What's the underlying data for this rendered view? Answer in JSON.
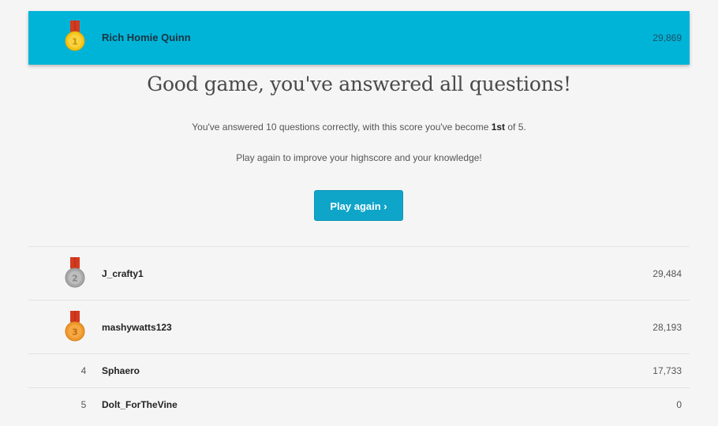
{
  "player": {
    "medal_icon": "gold-medal-icon",
    "medal_number": "1",
    "name": "Rich Homie Quinn",
    "score": "29,869"
  },
  "result": {
    "headline": "Good game, you've answered all questions!",
    "line1_pre": "You've answered 10 questions correctly, with this score you've become ",
    "line1_rank": "1st",
    "line1_post": " of 5.",
    "line2": "Play again to improve your highscore and your knowledge!",
    "play_again_label": "Play again ›"
  },
  "leaderboard": [
    {
      "rank": "2",
      "medal_icon": "silver-medal-icon",
      "name": "J_crafty1",
      "score": "29,484"
    },
    {
      "rank": "3",
      "medal_icon": "bronze-medal-icon",
      "name": "mashywatts123",
      "score": "28,193"
    },
    {
      "rank": "4",
      "name": "Sphaero",
      "score": "17,733"
    },
    {
      "rank": "5",
      "name": "Dolt_ForTheVine",
      "score": "0"
    }
  ],
  "colors": {
    "accent": "#00b4d8",
    "button": "#0fa5c9",
    "gold": "#f5c518",
    "silver": "#a8a8a8",
    "bronze": "#f0982c",
    "ribbon": "#d43a1f"
  }
}
